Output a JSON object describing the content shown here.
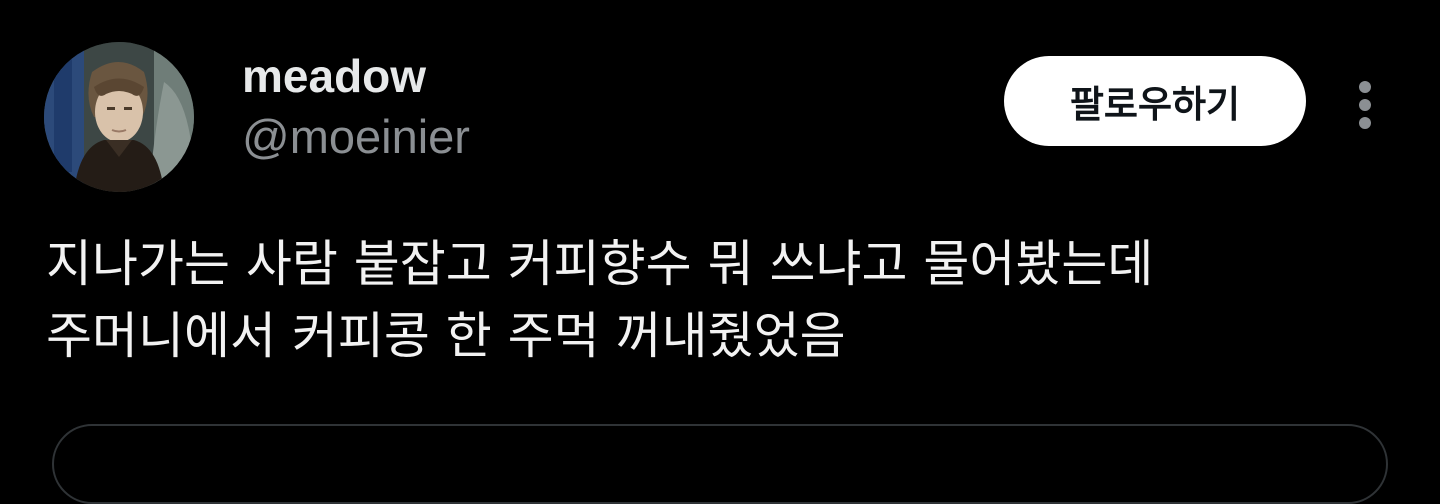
{
  "user": {
    "display_name": "meadow",
    "handle": "@moeinier",
    "avatar_icon": "profile-photo"
  },
  "actions": {
    "follow_label": "팔로우하기",
    "more_icon": "more-vertical-icon"
  },
  "tweet": {
    "lines": [
      "지나가는 사람 붙잡고 커피향수 뭐 쓰냐고 물어봤는데",
      "주머니에서 커피콩 한 주먹 꺼내줬었음"
    ]
  },
  "colors": {
    "background": "#000000",
    "text_primary": "#e7e9ea",
    "text_secondary": "#8b8f93",
    "button_bg": "#ffffff",
    "button_text": "#0f1419",
    "border": "#2f3336"
  }
}
